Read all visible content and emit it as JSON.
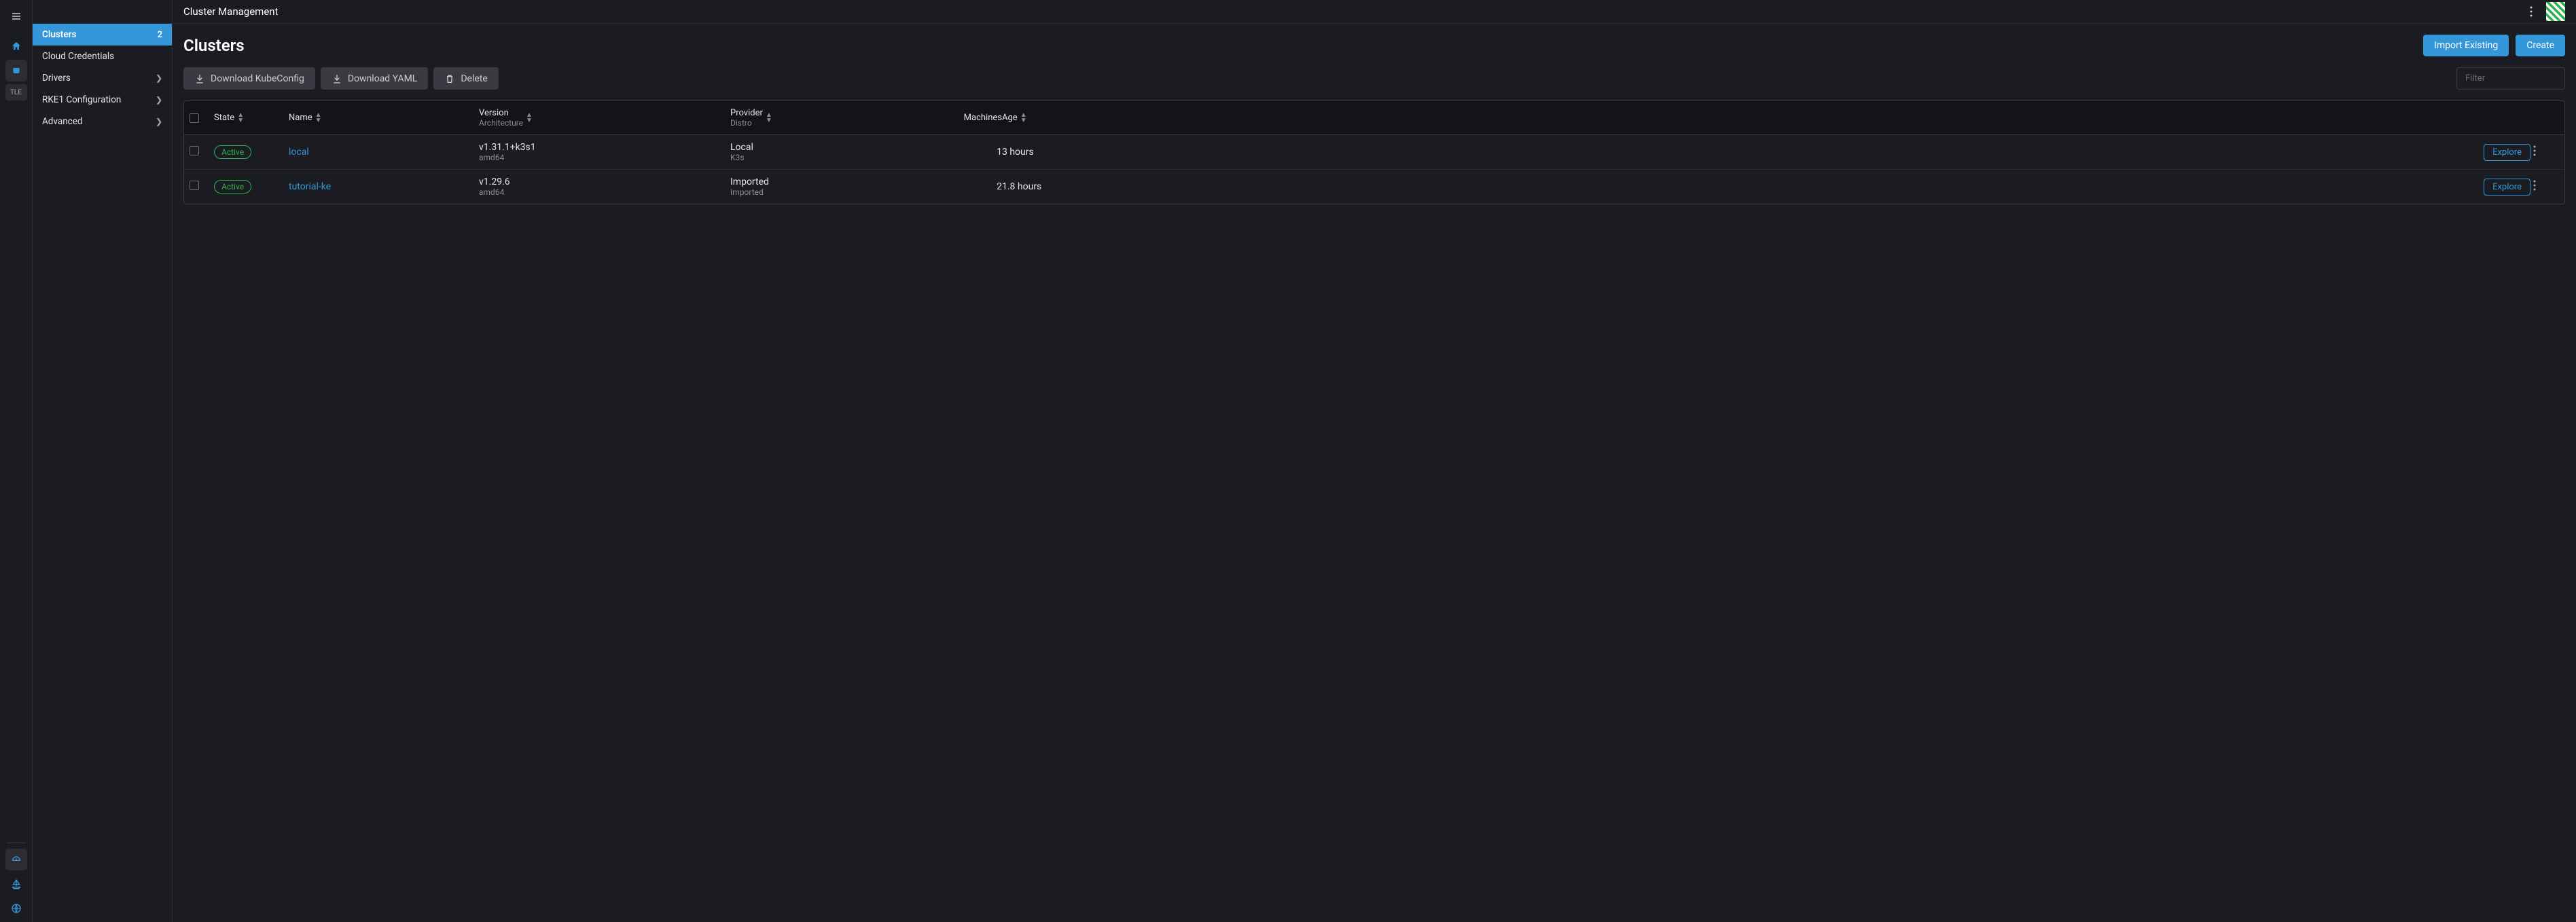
{
  "topbar": {
    "title": "Cluster Management"
  },
  "rail": {
    "tle_label": "TLE"
  },
  "sidebar": {
    "items": [
      {
        "label": "Clusters",
        "badge": "2",
        "active": true,
        "chevron": false
      },
      {
        "label": "Cloud Credentials",
        "chevron": false
      },
      {
        "label": "Drivers",
        "chevron": true
      },
      {
        "label": "RKE1 Configuration",
        "chevron": true
      },
      {
        "label": "Advanced",
        "chevron": true
      }
    ]
  },
  "page": {
    "title": "Clusters",
    "import_label": "Import Existing",
    "create_label": "Create"
  },
  "toolbar": {
    "download_kubeconfig": "Download KubeConfig",
    "download_yaml": "Download YAML",
    "delete": "Delete",
    "filter_placeholder": "Filter"
  },
  "table": {
    "headers": {
      "state": "State",
      "name": "Name",
      "version": "Version",
      "version_sub": "Architecture",
      "provider": "Provider",
      "provider_sub": "Distro",
      "machines": "Machines",
      "age": "Age"
    },
    "rows": [
      {
        "state": "Active",
        "name": "local",
        "version": "v1.31.1+k3s1",
        "arch": "amd64",
        "provider": "Local",
        "distro": "K3s",
        "machines": "1",
        "age": "3 hours",
        "explore": "Explore"
      },
      {
        "state": "Active",
        "name": "tutorial-ke",
        "version": "v1.29.6",
        "arch": "amd64",
        "provider": "Imported",
        "distro": "Imported",
        "machines": "2",
        "age": "1.8 hours",
        "explore": "Explore"
      }
    ]
  }
}
